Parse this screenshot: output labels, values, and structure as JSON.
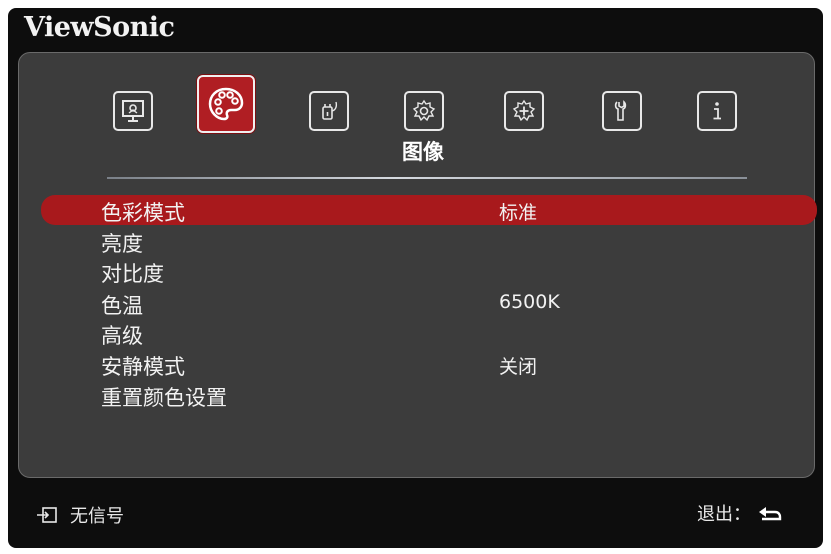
{
  "brand": "ViewSonic",
  "tabs": [
    {
      "icon": "display-icon"
    },
    {
      "icon": "palette-icon",
      "active": true
    },
    {
      "icon": "power-plug-icon"
    },
    {
      "icon": "gear-icon"
    },
    {
      "icon": "advanced-gear-icon"
    },
    {
      "icon": "wrench-icon"
    },
    {
      "icon": "info-icon"
    }
  ],
  "active_tab_title": "图像",
  "menu": [
    {
      "label": "色彩模式",
      "value": "标准",
      "selected": true
    },
    {
      "label": "亮度",
      "value": ""
    },
    {
      "label": "对比度",
      "value": ""
    },
    {
      "label": "色温",
      "value": "6500K"
    },
    {
      "label": "高级",
      "value": ""
    },
    {
      "label": "安静模式",
      "value": "关闭"
    },
    {
      "label": "重置颜色设置",
      "value": ""
    }
  ],
  "footer": {
    "signal_text": "无信号",
    "exit_text": "退出："
  },
  "colors": {
    "accent": "#b01e23",
    "panel": "#3c3c3c",
    "frame": "#0d0d0d"
  }
}
